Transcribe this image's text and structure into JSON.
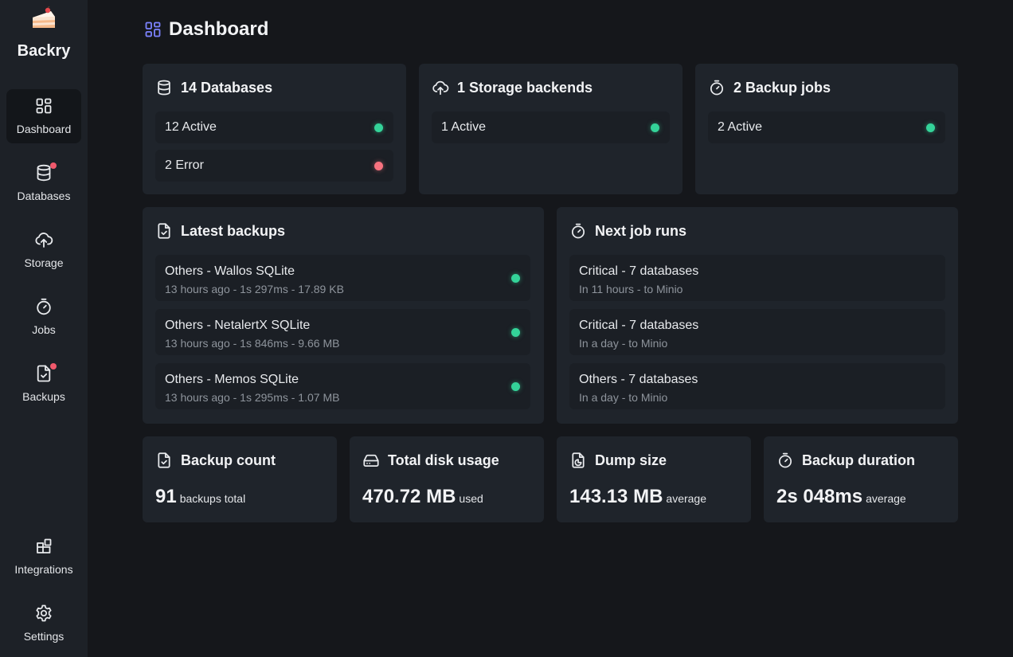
{
  "app": {
    "name": "Backry",
    "logo_icon": "cake-slice-icon"
  },
  "sidebar": {
    "items": [
      {
        "label": "Dashboard",
        "icon": "grid-icon",
        "active": true,
        "badge": false
      },
      {
        "label": "Databases",
        "icon": "database-icon",
        "active": false,
        "badge": true
      },
      {
        "label": "Storage",
        "icon": "cloud-upload-icon",
        "active": false,
        "badge": false
      },
      {
        "label": "Jobs",
        "icon": "timer-icon",
        "active": false,
        "badge": false
      },
      {
        "label": "Backups",
        "icon": "file-check-icon",
        "active": false,
        "badge": true
      }
    ],
    "bottom_items": [
      {
        "label": "Integrations",
        "icon": "blocks-icon"
      },
      {
        "label": "Settings",
        "icon": "gear-icon"
      }
    ]
  },
  "page": {
    "title": "Dashboard",
    "icon": "grid-icon"
  },
  "summary": {
    "databases": {
      "title": "14 Databases",
      "rows": [
        {
          "label": "12 Active",
          "status": "ok"
        },
        {
          "label": "2 Error",
          "status": "error"
        }
      ]
    },
    "storage": {
      "title": "1 Storage backends",
      "rows": [
        {
          "label": "1 Active",
          "status": "ok"
        }
      ]
    },
    "jobs": {
      "title": "2 Backup jobs",
      "rows": [
        {
          "label": "2 Active",
          "status": "ok"
        }
      ]
    }
  },
  "latest_backups": {
    "title": "Latest backups",
    "items": [
      {
        "title": "Others - Wallos SQLite",
        "subtitle": "13 hours ago - 1s 297ms - 17.89 KB",
        "status": "ok"
      },
      {
        "title": "Others - NetalertX SQLite",
        "subtitle": "13 hours ago - 1s 846ms - 9.66 MB",
        "status": "ok"
      },
      {
        "title": "Others - Memos SQLite",
        "subtitle": "13 hours ago - 1s 295ms - 1.07 MB",
        "status": "ok"
      }
    ]
  },
  "next_job_runs": {
    "title": "Next job runs",
    "items": [
      {
        "title": "Critical - 7 databases",
        "subtitle": "In 11 hours - to Minio"
      },
      {
        "title": "Critical - 7 databases",
        "subtitle": "In a day - to Minio"
      },
      {
        "title": "Others - 7 databases",
        "subtitle": "In a day - to Minio"
      }
    ]
  },
  "stats": [
    {
      "title": "Backup count",
      "icon": "file-check-icon",
      "value": "91",
      "unit": "backups total"
    },
    {
      "title": "Total disk usage",
      "icon": "hard-drive-icon",
      "value": "470.72 MB",
      "unit": "used"
    },
    {
      "title": "Dump size",
      "icon": "file-chart-icon",
      "value": "143.13 MB",
      "unit": "average"
    },
    {
      "title": "Backup duration",
      "icon": "timer-icon",
      "value": "2s 048ms",
      "unit": "average"
    }
  ],
  "colors": {
    "background": "#15171b",
    "sidebar": "#1d2127",
    "card": "#1f242b",
    "row": "#1b1f25",
    "accent": "#7c83ff",
    "status_ok": "#34d399",
    "status_error": "#f8727f",
    "badge": "#f0596c"
  }
}
